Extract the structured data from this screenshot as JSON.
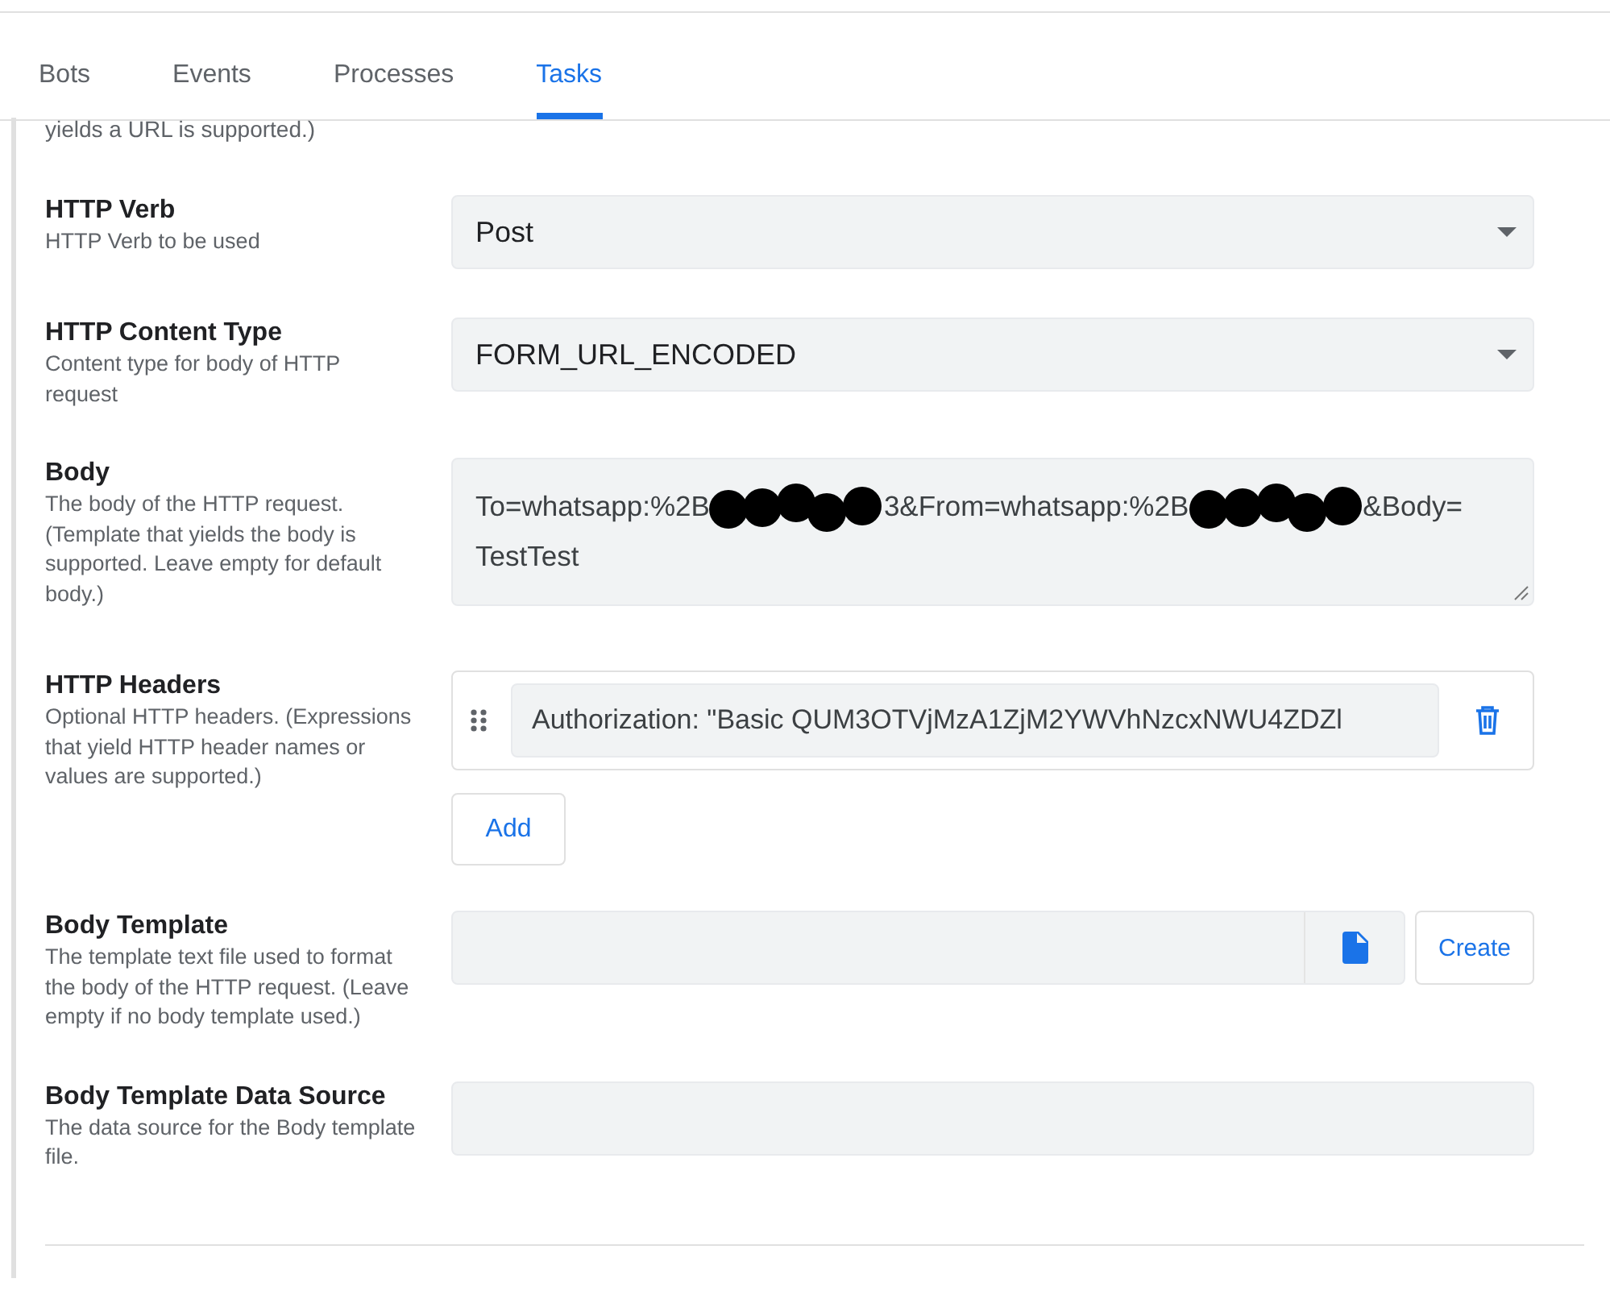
{
  "tabs": [
    {
      "label": "Bots",
      "selected": false
    },
    {
      "label": "Events",
      "selected": false
    },
    {
      "label": "Processes",
      "selected": false
    },
    {
      "label": "Tasks",
      "selected": true
    }
  ],
  "clipped_description": "yields a URL is supported.)",
  "fields": [
    {
      "kind": "select",
      "label": "HTTP Verb",
      "description": "HTTP Verb to be used",
      "value": "Post"
    },
    {
      "kind": "select",
      "label": "HTTP Content Type",
      "description": "Content type for body of HTTP request",
      "value": "FORM_URL_ENCODED"
    },
    {
      "kind": "textarea",
      "label": "Body",
      "description": "The body of the HTTP request. (Template that yields the body is supported. Leave empty for default body.)",
      "segments": [
        {
          "kind": "text",
          "text": "To=whatsapp:%2B"
        },
        {
          "kind": "redaction"
        },
        {
          "kind": "text",
          "text": "3&From=whatsapp:%2B"
        },
        {
          "kind": "redaction"
        },
        {
          "kind": "text",
          "text": "&Body="
        },
        {
          "kind": "text",
          "text": "TestTest"
        }
      ]
    },
    {
      "kind": "headers",
      "label": "HTTP Headers",
      "description": "Optional HTTP headers. (Expressions that yield HTTP header names or values are supported.)",
      "headers": [
        "Authorization: \"Basic QUM3OTVjMzA1ZjM2YWVhNzcxNWU4ZDZl"
      ],
      "add_label": "Add"
    },
    {
      "kind": "file",
      "label": "Body Template",
      "description": "The template text file used to format the body of the HTTP request. (Leave empty if no body template used.)",
      "button": "Create"
    },
    {
      "kind": "text",
      "label": "Body Template Data Source",
      "description": "The data source for the Body template file."
    }
  ]
}
